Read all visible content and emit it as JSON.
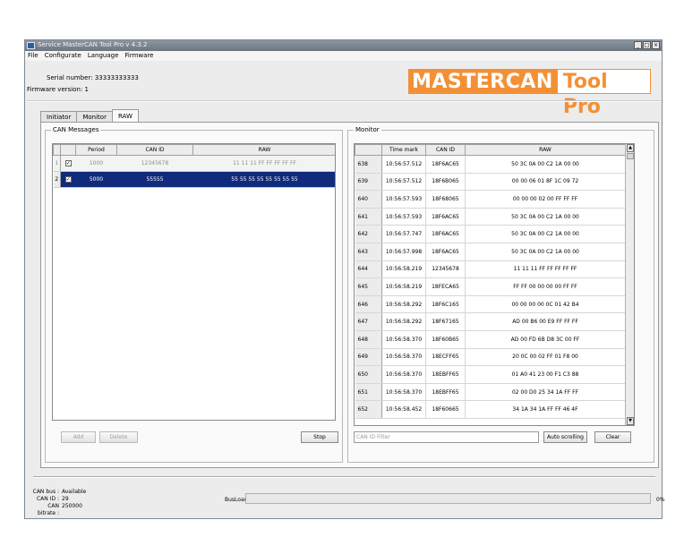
{
  "window": {
    "title": "Service MasterCAN Tool Pro v 4.3.2",
    "minimize": "_",
    "maximize": "□",
    "close": "×"
  },
  "menu": [
    "File",
    "Configurate",
    "Language",
    "Firmware"
  ],
  "device": {
    "serial_label": "Serial number:",
    "serial_value": "33333333333",
    "firmware_label": "Firmware version:",
    "firmware_value": "1"
  },
  "logo": {
    "part1": "MASTERCAN",
    "part2": "Tool Pro",
    "color": "#f39035"
  },
  "tabs": [
    "Initiator",
    "Monitor",
    "RAW"
  ],
  "active_tab": "RAW",
  "can_messages": {
    "legend": "CAN Messages",
    "columns": [
      "Period",
      "CAN ID",
      "RAW"
    ],
    "rows": [
      {
        "index": "1",
        "checked": true,
        "period": "1000",
        "can_id": "12345678",
        "raw": "11 11 11 FF FF FF FF FF",
        "state": "disabled"
      },
      {
        "index": "2",
        "checked": true,
        "period": "5000",
        "can_id": "55555",
        "raw": "55 55 55 55 55 55 55 55",
        "state": "selected"
      }
    ],
    "add_label": "Add",
    "delete_label": "Delete",
    "stop_label": "Stop"
  },
  "monitor": {
    "legend": "Monitor",
    "columns": [
      "Time mark",
      "CAN ID",
      "RAW"
    ],
    "rows": [
      {
        "n": "638",
        "time": "10:56:57.512",
        "id": "18F6AC65",
        "raw": "50 3C 0A 00 C2 1A 00 00"
      },
      {
        "n": "639",
        "time": "10:56:57.512",
        "id": "18F6B065",
        "raw": "00 00 06 01 8F 1C 09 72"
      },
      {
        "n": "640",
        "time": "10:56:57.593",
        "id": "18F68065",
        "raw": "00 00 00 02 00 FF FF FF"
      },
      {
        "n": "641",
        "time": "10:56:57.593",
        "id": "18F6AC65",
        "raw": "50 3C 0A 00 C2 1A 00 00"
      },
      {
        "n": "642",
        "time": "10:56:57.747",
        "id": "18F6AC65",
        "raw": "50 3C 0A 00 C2 1A 00 00"
      },
      {
        "n": "643",
        "time": "10:56:57.998",
        "id": "18F6AC65",
        "raw": "50 3C 0A 00 C2 1A 00 00"
      },
      {
        "n": "644",
        "time": "10:56:58.219",
        "id": "12345678",
        "raw": "11 11 11 FF FF FF FF FF"
      },
      {
        "n": "645",
        "time": "10:56:58.219",
        "id": "18FECA65",
        "raw": "FF FF 00 00 00 00 FF FF"
      },
      {
        "n": "646",
        "time": "10:56:58.292",
        "id": "18F6C165",
        "raw": "00 00 00 00 0C 01 42 B4"
      },
      {
        "n": "647",
        "time": "10:56:58.292",
        "id": "18F67165",
        "raw": "AD 00 B6 00 E9 FF FF FF"
      },
      {
        "n": "648",
        "time": "10:56:58.370",
        "id": "18F60B65",
        "raw": "AD 00 FD 6B D8 3C 00 FF"
      },
      {
        "n": "649",
        "time": "10:56:58.370",
        "id": "18ECFF65",
        "raw": "20 0C 00 02 FF 01 F8 00"
      },
      {
        "n": "650",
        "time": "10:56:58.370",
        "id": "18EBFF65",
        "raw": "01 A0 41 23 00 F1 C3 88"
      },
      {
        "n": "651",
        "time": "10:56:58.370",
        "id": "18EBFF65",
        "raw": "02 00 D0 25 34 1A FF FF"
      },
      {
        "n": "652",
        "time": "10:56:58.452",
        "id": "18F60665",
        "raw": "34 1A 34 1A FF FF 46 4F"
      }
    ],
    "filter_placeholder": "CAN ID Filter",
    "autoscroll_label": "Auto scrolling",
    "clear_label": "Clear"
  },
  "status": {
    "bus_label": "CAN bus :",
    "bus_value": "Available",
    "id_label": "CAN ID :",
    "id_value": "29",
    "bitrate_label": "CAN bitrate :",
    "bitrate_value": "250000",
    "busload_label": "BusLoad:",
    "busload_value": "0%",
    "busload_fraction": 0
  },
  "colors": {
    "selection": "#102a7c",
    "accent": "#f39035"
  }
}
